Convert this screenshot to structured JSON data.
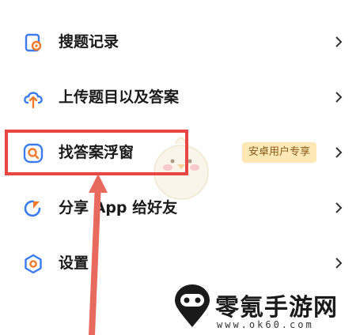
{
  "menu": {
    "items": [
      {
        "label": "搜题记录",
        "icon": "history-search-icon"
      },
      {
        "label": "上传题目以及答案",
        "icon": "upload-cloud-icon"
      },
      {
        "label": "找答案浮窗",
        "icon": "floating-search-icon",
        "badge": "安卓用户专享"
      },
      {
        "label": "分享 App 给好友",
        "icon": "share-icon"
      },
      {
        "label": "设置",
        "icon": "settings-icon"
      }
    ]
  },
  "watermark": {
    "name": "零氪手游网",
    "url": "www.ok60.com"
  },
  "colors": {
    "accent": "#3a7bf0",
    "highlight": "#e84545",
    "badge_bg": "#fde8b6",
    "badge_text": "#8a5a1a",
    "orange": "#f07a2a"
  }
}
